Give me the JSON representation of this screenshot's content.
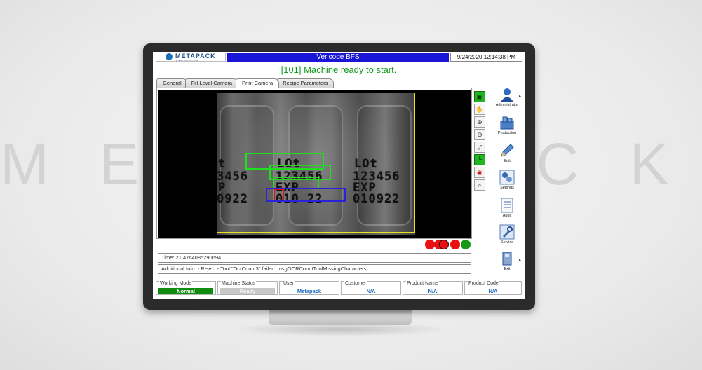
{
  "background_watermark": "METAPACK",
  "titlebar": {
    "logo_text": "METAPACK",
    "logo_sub": "ENGINEERING",
    "app_title": "Vericode BFS",
    "datetime": "9/24/2020 12:14:38 PM"
  },
  "status_message": "[101] Machine ready to start.",
  "tabs": [
    {
      "label": "General",
      "active": false
    },
    {
      "label": "Fill Level Camera",
      "active": false
    },
    {
      "label": "Print Camera",
      "active": true
    },
    {
      "label": "Recipe Parameters",
      "active": false
    }
  ],
  "camera": {
    "ocr_lines": {
      "left_l1": "t",
      "left_l2": "3456",
      "left_l3": "P",
      "left_l4": "0922",
      "center_l1": "LOt",
      "center_l2": "123456",
      "center_l3": "EXP",
      "center_l4": "010 22",
      "right_l1": "LOt",
      "right_l2": "123456",
      "right_l3": "EXP",
      "right_l4": "010922"
    }
  },
  "tools": [
    {
      "name": "select-tool-icon",
      "glyph": "▣",
      "active": true
    },
    {
      "name": "hand-tool-icon",
      "glyph": "✋",
      "active": false
    },
    {
      "name": "zoom-in-icon",
      "glyph": "⊕",
      "active": false
    },
    {
      "name": "zoom-out-icon",
      "glyph": "⊖",
      "active": false
    },
    {
      "name": "fit-icon",
      "glyph": "⤢",
      "active": false
    },
    {
      "name": "roi-tool-icon",
      "glyph": "┗",
      "active": true
    },
    {
      "name": "record-icon",
      "glyph": "◉",
      "active": false
    },
    {
      "name": "search-icon",
      "glyph": "⌕",
      "active": false
    }
  ],
  "indicators": [
    {
      "color": "#e81010"
    },
    {
      "color": "#e81010"
    },
    {
      "color": "#e81010"
    },
    {
      "color": "#e81010"
    },
    {
      "color": "#149a14"
    }
  ],
  "info": {
    "time": "Time: 21.4764085290694",
    "additional": "Additional Info: - Reject - Tool \"OcrCount3\" failed: msgOCRCountToolMissingCharacters"
  },
  "sidebar": [
    {
      "label": "Administrator",
      "icon": "user-icon"
    },
    {
      "label": "Production",
      "icon": "production-icon"
    },
    {
      "label": "Edit",
      "icon": "edit-icon"
    },
    {
      "label": "Settings",
      "icon": "settings-icon"
    },
    {
      "label": "Audit",
      "icon": "audit-icon"
    },
    {
      "label": "Service",
      "icon": "service-icon"
    },
    {
      "label": "Exit",
      "icon": "exit-icon"
    }
  ],
  "status_fields": {
    "working_mode": {
      "label": "Working Mode",
      "value": "Normal",
      "bg": "#0f8c10",
      "color": "#ffffff"
    },
    "machine_status": {
      "label": "Machine Status",
      "value": "Ready",
      "bg": "#c8c8c8",
      "color": "#f4f4f4"
    },
    "user": {
      "label": "User",
      "value": "Metapack"
    },
    "customer": {
      "label": "Customer",
      "value": "N/A"
    },
    "product_name": {
      "label": "Product Name",
      "value": "N/A"
    },
    "product_code": {
      "label": "Product Code",
      "value": "N/A"
    }
  },
  "colors": {
    "title_blue": "#1a16d8",
    "status_green": "#0f9a1c",
    "roi_green": "#1fe01f",
    "roi_blue": "#2a22d8",
    "roi_yellow": "#e6e61a"
  }
}
